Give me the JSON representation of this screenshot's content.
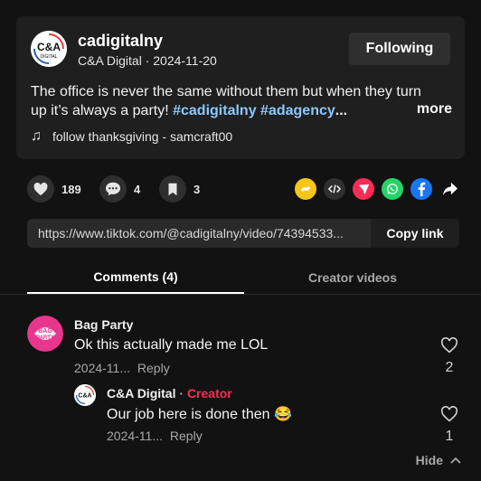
{
  "post": {
    "author_name": "cadigitalny",
    "author_sub": "C&A Digital · 2024-11-20",
    "avatar_logo_text": "C&A",
    "avatar_logo_sub": "DIGITAL",
    "follow_label": "Following",
    "desc_line1": "The office is never the same without them but when they turn",
    "desc_line2_text": "up it’s always a party! ",
    "hashtag1": "#cadigitalny",
    "hashtag2": "#adagency",
    "ellipsis": "...",
    "more_label": "more",
    "music": "follow thanksgiving - samcraft00"
  },
  "actions": {
    "likes": "189",
    "comments": "4",
    "saves": "3"
  },
  "share_icons": [
    {
      "name": "repost-icon",
      "color": "#f5c518"
    },
    {
      "name": "embed-icon",
      "color": "#2f2f2f"
    },
    {
      "name": "send-icon",
      "color": "#fe2c55"
    },
    {
      "name": "whatsapp-icon",
      "color": "#25d366"
    },
    {
      "name": "facebook-icon",
      "color": "#1877f2"
    },
    {
      "name": "share-arrow-icon",
      "color": "#121212"
    }
  ],
  "link": {
    "url": "https://www.tiktok.com/@cadigitalny/video/74394533...",
    "copy_label": "Copy link"
  },
  "tabs": [
    {
      "label": "Comments (4)",
      "active": true
    },
    {
      "label": "Creator videos",
      "active": false
    }
  ],
  "comments": [
    {
      "avatar_text": "BAG PARTY",
      "name": "Bag Party",
      "text": "Ok this actually made me LOL",
      "date": "2024-11...",
      "reply_label": "Reply",
      "likes": "2"
    }
  ],
  "replies": [
    {
      "avatar_text": "C&A",
      "name": "C&A Digital",
      "badge_sep": " · ",
      "badge": "Creator",
      "text": "Our job here is done then 😂",
      "date": "2024-11...",
      "reply_label": "Reply",
      "likes": "1"
    }
  ],
  "hide_label": "Hide"
}
